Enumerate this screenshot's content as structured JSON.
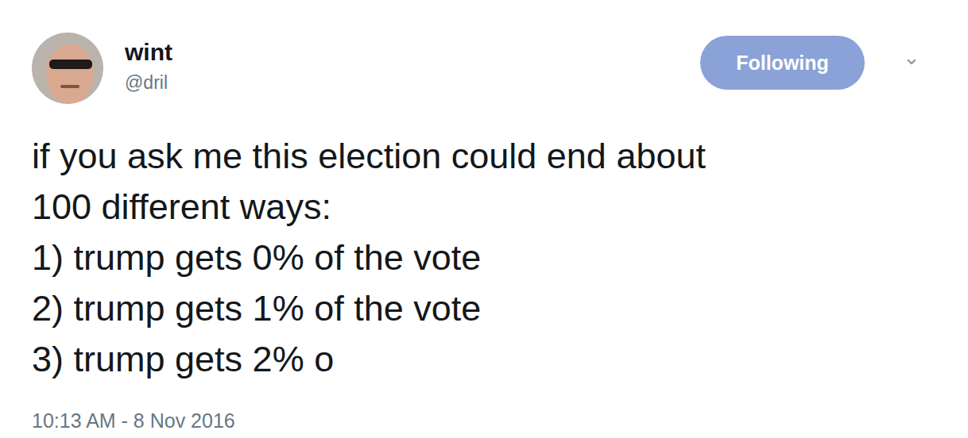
{
  "user": {
    "name": "wint",
    "handle": "@dril"
  },
  "follow_button": {
    "label": "Following",
    "following": true
  },
  "menu": {
    "icon": "⌄"
  },
  "tweet": {
    "lines": [
      "if you ask me this election could end about",
      "100 different ways:",
      "1) trump gets 0% of the vote",
      "2) trump gets 1% of the vote",
      "3) trump gets 2% o"
    ]
  },
  "timestamp": "10:13 AM - 8 Nov 2016"
}
